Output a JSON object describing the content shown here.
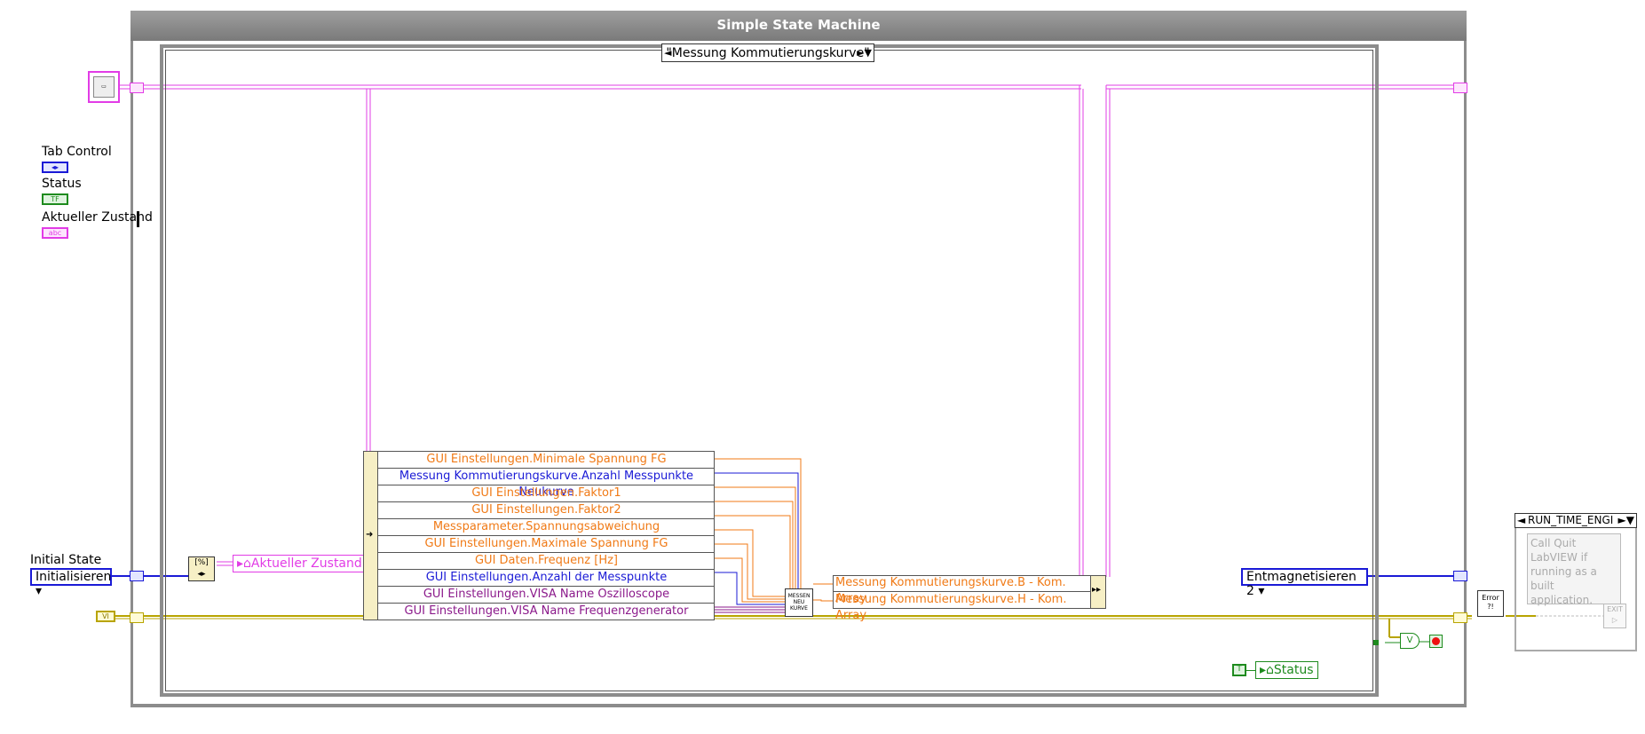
{
  "window": {
    "title": "Simple State Machine"
  },
  "case_selector": {
    "value": "\"Messung Kommutierungskurve\"",
    "left_arrow": "◄",
    "right_arrow": "►▼"
  },
  "left_controls": {
    "tab_control_label": "Tab Control",
    "status_label": "Status",
    "aktueller_zustand_label": "Aktueller Zustand",
    "initial_state_label": "Initial State",
    "initial_state_value": "Initialisieren",
    "status_term_text": "TF",
    "string_term_text": "abc",
    "vi_ref_text": "VI"
  },
  "local_variables": {
    "aktueller_zustand": "Aktueller Zustand",
    "status": "Status"
  },
  "unbundle_rows": [
    {
      "text": "GUI Einstellungen.Minimale Spannung FG",
      "color": "#f07a16"
    },
    {
      "text": "Messung Kommutierungskurve.Anzahl Messpunkte Neukurve",
      "color": "#1a1ad6"
    },
    {
      "text": "GUI Einstellungen.Faktor1",
      "color": "#f07a16"
    },
    {
      "text": "GUI Einstellungen.Faktor2",
      "color": "#f07a16"
    },
    {
      "text": "Messparameter.Spannungsabweichung",
      "color": "#f07a16"
    },
    {
      "text": "GUI Einstellungen.Maximale Spannung FG",
      "color": "#f07a16"
    },
    {
      "text": "GUI Daten.Frequenz [Hz]",
      "color": "#f07a16"
    },
    {
      "text": "GUI Einstellungen.Anzahl der Messpunkte",
      "color": "#1a1ad6"
    },
    {
      "text": "GUI Einstellungen.VISA Name Oszilloscope",
      "color": "#8b1a8b"
    },
    {
      "text": "GUI Einstellungen.VISA Name Frequenzgenerator",
      "color": "#8b1a8b"
    }
  ],
  "bundle_rows": [
    {
      "text": "Messung Kommutierungskurve.B - Kom. Array",
      "color": "#f07a16"
    },
    {
      "text": "Messung Kommutierungskurve.H - Kom. Array",
      "color": "#f07a16"
    }
  ],
  "subvi": {
    "line1": "MESSEN",
    "line2": "NEU",
    "line3": "KURVE"
  },
  "next_state": {
    "value": "Entmagnetisieren 2"
  },
  "error_node": {
    "text": "Error ?!"
  },
  "runtime_case": {
    "value": "RUN_TIME_ENGI"
  },
  "comment": {
    "text": "Call Quit LabVIEW if running as a built application."
  },
  "true_const": {
    "text": "T"
  },
  "colors": {
    "string_wire": "#e23ce6",
    "enum_wire": "#1a1ad6",
    "error_wire": "#b8a400",
    "numeric_wire": "#f07a16",
    "frame": "#8c8c8c"
  }
}
